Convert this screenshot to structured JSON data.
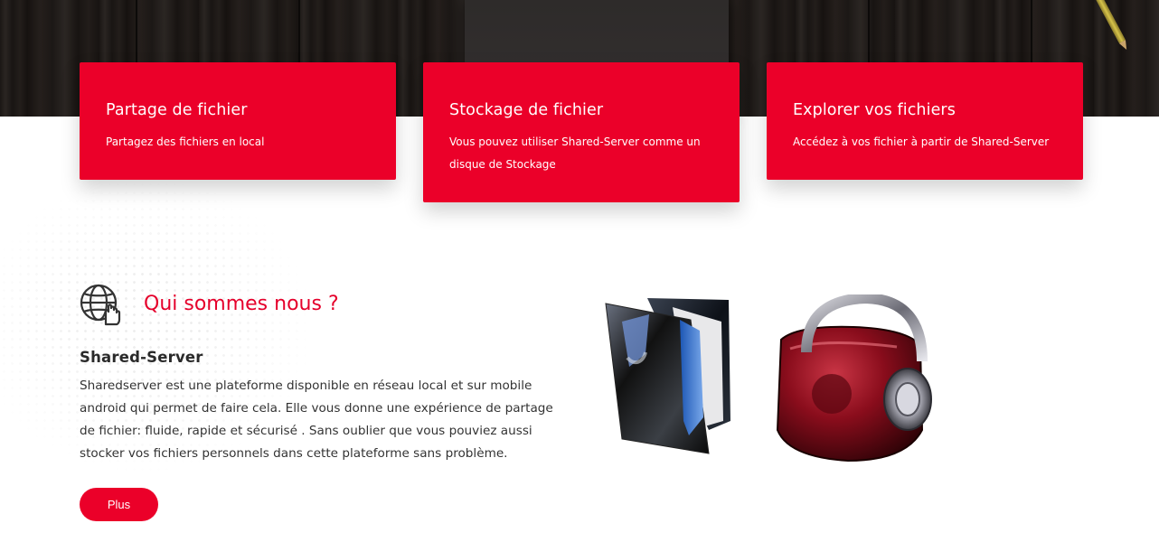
{
  "cards": [
    {
      "title": "Partage de fichier",
      "text": "Partagez des fichiers en local"
    },
    {
      "title": "Stockage de fichier",
      "text": "Vous pouvez utiliser Shared-Server comme un disque de Stockage"
    },
    {
      "title": "Explorer vos fichiers",
      "text": "Accédez à vos fichier à partir de Shared-Server"
    }
  ],
  "about": {
    "icon": "globe-hand-icon",
    "title": "Qui sommes nous ?",
    "subtitle": "Shared-Server",
    "body": "Sharedserver est une plateforme disponible en réseau local et sur mobile android qui permet de faire cela. Elle vous donne une expérience de partage de fichier: fluide, rapide et sécurisé . Sans oublier que vous pouviez aussi stocker vos fichiers personnels dans cette plateforme sans problème.",
    "button_label": "Plus"
  },
  "images": {
    "folder": "folder-icon",
    "headphones": "headphones-bag-icon"
  },
  "colors": {
    "accent": "#eb0029",
    "heading_red": "#e5002b",
    "hero_dark": "#1e1a18",
    "text": "#333333"
  }
}
